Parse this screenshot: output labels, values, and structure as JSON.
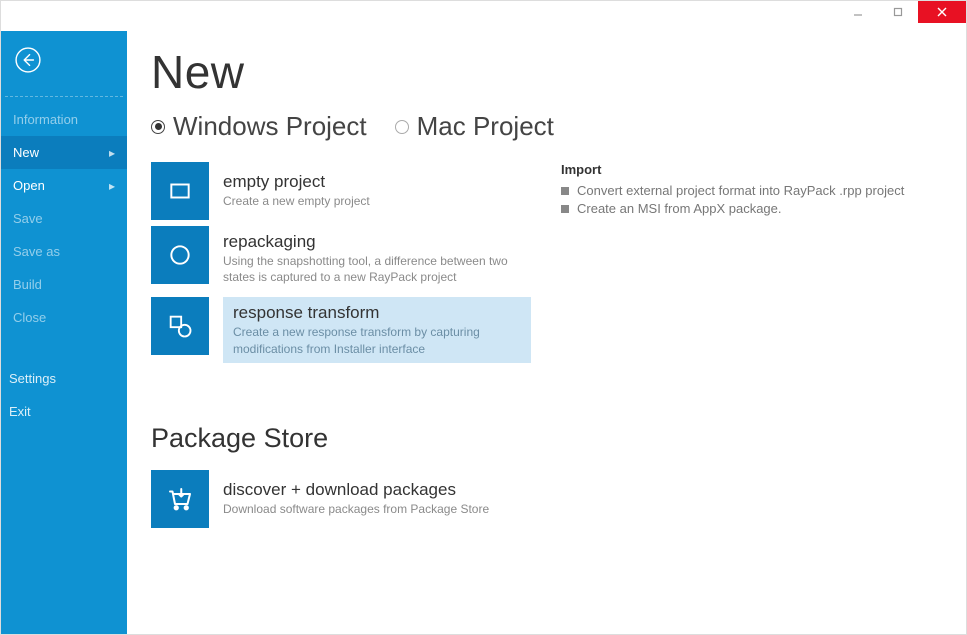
{
  "sidebar": {
    "items": [
      {
        "label": "Information",
        "active": false,
        "bold": false,
        "chevron": false
      },
      {
        "label": "New",
        "active": true,
        "bold": true,
        "chevron": true
      },
      {
        "label": "Open",
        "active": false,
        "bold": true,
        "chevron": true
      },
      {
        "label": "Save",
        "active": false,
        "bold": false,
        "chevron": false,
        "dim": true
      },
      {
        "label": "Save as",
        "active": false,
        "bold": false,
        "chevron": false,
        "dim": true
      },
      {
        "label": "Build",
        "active": false,
        "bold": false,
        "chevron": false,
        "dim": true
      },
      {
        "label": "Close",
        "active": false,
        "bold": false,
        "chevron": false,
        "dim": true
      }
    ],
    "lower": [
      {
        "label": "Settings"
      },
      {
        "label": "Exit"
      }
    ]
  },
  "page": {
    "title": "New"
  },
  "tabs": [
    {
      "label": "Windows Project",
      "selected": true
    },
    {
      "label": "Mac Project",
      "selected": false
    }
  ],
  "tiles": [
    {
      "title": "empty project",
      "desc": "Create a new empty project",
      "icon": "square"
    },
    {
      "title": "repackaging",
      "desc": "Using the snapshotting tool, a difference between two states is captured to a new RayPack project",
      "icon": "circle"
    },
    {
      "title": "response transform",
      "desc": "Create a new response transform by capturing modifications from Installer interface",
      "icon": "transform",
      "highlight": true
    }
  ],
  "import": {
    "heading": "Import",
    "items": [
      "Convert external project format into RayPack .rpp project",
      "Create an MSI from AppX package."
    ]
  },
  "store": {
    "section": "Package Store",
    "tile": {
      "title": "discover + download packages",
      "desc": "Download software packages from Package Store"
    }
  }
}
